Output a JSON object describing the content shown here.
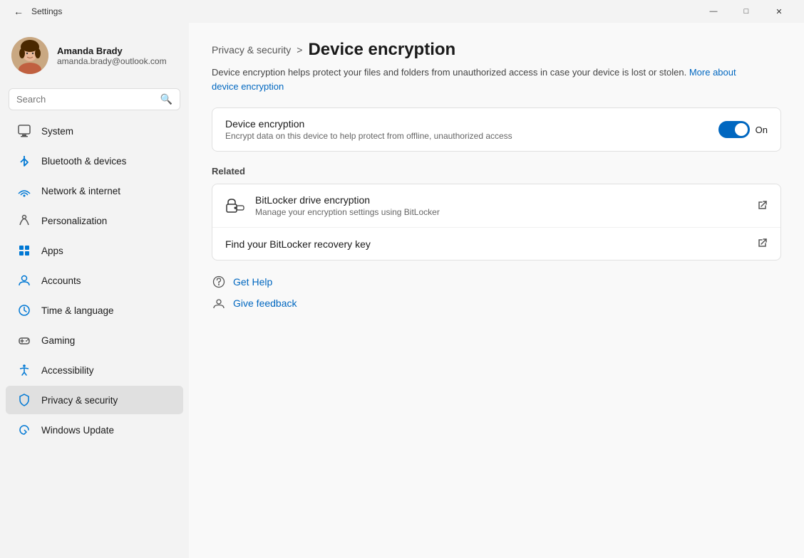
{
  "titlebar": {
    "title": "Settings",
    "minimize": "—",
    "maximize": "□",
    "close": "✕"
  },
  "user": {
    "name": "Amanda Brady",
    "email": "amanda.brady@outlook.com"
  },
  "search": {
    "placeholder": "Search"
  },
  "nav": {
    "items": [
      {
        "id": "system",
        "label": "System",
        "icon": "system"
      },
      {
        "id": "bluetooth",
        "label": "Bluetooth & devices",
        "icon": "bluetooth"
      },
      {
        "id": "network",
        "label": "Network & internet",
        "icon": "network"
      },
      {
        "id": "personalization",
        "label": "Personalization",
        "icon": "personalization"
      },
      {
        "id": "apps",
        "label": "Apps",
        "icon": "apps"
      },
      {
        "id": "accounts",
        "label": "Accounts",
        "icon": "accounts"
      },
      {
        "id": "time",
        "label": "Time & language",
        "icon": "time"
      },
      {
        "id": "gaming",
        "label": "Gaming",
        "icon": "gaming"
      },
      {
        "id": "accessibility",
        "label": "Accessibility",
        "icon": "accessibility"
      },
      {
        "id": "privacy",
        "label": "Privacy & security",
        "icon": "privacy",
        "active": true
      },
      {
        "id": "update",
        "label": "Windows Update",
        "icon": "update"
      }
    ]
  },
  "breadcrumb": {
    "parent": "Privacy & security",
    "separator": ">",
    "current": "Device encryption"
  },
  "description": {
    "text": "Device encryption helps protect your files and folders from unauthorized access in case your device is lost or stolen.",
    "link_text": "More about device encryption",
    "link_url": "#"
  },
  "device_encryption": {
    "title": "Device encryption",
    "description": "Encrypt data on this device to help protect from offline, unauthorized access",
    "toggle_state": "On",
    "toggle_on": true
  },
  "related": {
    "label": "Related",
    "items": [
      {
        "id": "bitlocker",
        "title": "BitLocker drive encryption",
        "description": "Manage your encryption settings using BitLocker",
        "has_icon": true
      },
      {
        "id": "recovery-key",
        "title": "Find your BitLocker recovery key",
        "description": "",
        "has_icon": false
      }
    ]
  },
  "help": {
    "get_help_label": "Get Help",
    "give_feedback_label": "Give feedback"
  }
}
